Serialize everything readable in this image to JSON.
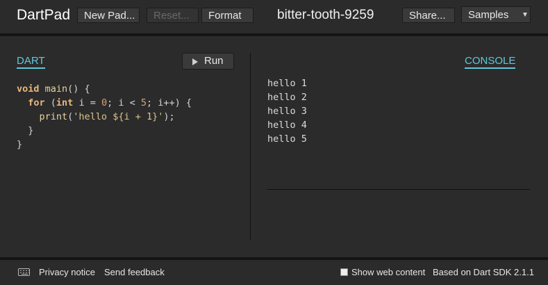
{
  "header": {
    "app_title": "DartPad",
    "new_pad_label": "New Pad...",
    "reset_label": "Reset...",
    "format_label": "Format",
    "pad_name": "bitter-tooth-9259",
    "share_label": "Share...",
    "samples_label": "Samples"
  },
  "editor": {
    "tab_label": "DART",
    "run_label": "Run",
    "code": {
      "l1_kw": "void",
      "l1_fn": " main",
      "l1_rest": "() {",
      "l2_kw": "for",
      "l2_a": " (",
      "l2_kw2": "int",
      "l2_b": " i = ",
      "l2_n0": "0",
      "l2_c": "; i < ",
      "l2_n5": "5",
      "l2_d": "; i++) {",
      "l3_fn": "print",
      "l3_a": "(",
      "l3_str": "'hello ${i + 1}'",
      "l3_b": ");",
      "l4": "}",
      "l5": "}"
    }
  },
  "console": {
    "tab_label": "CONSOLE",
    "lines": [
      "hello 1",
      "hello 2",
      "hello 3",
      "hello 4",
      "hello 5"
    ]
  },
  "footer": {
    "privacy_label": "Privacy notice",
    "feedback_label": "Send feedback",
    "show_web_label": "Show web content",
    "sdk_label": "Based on Dart SDK 2.1.1"
  }
}
